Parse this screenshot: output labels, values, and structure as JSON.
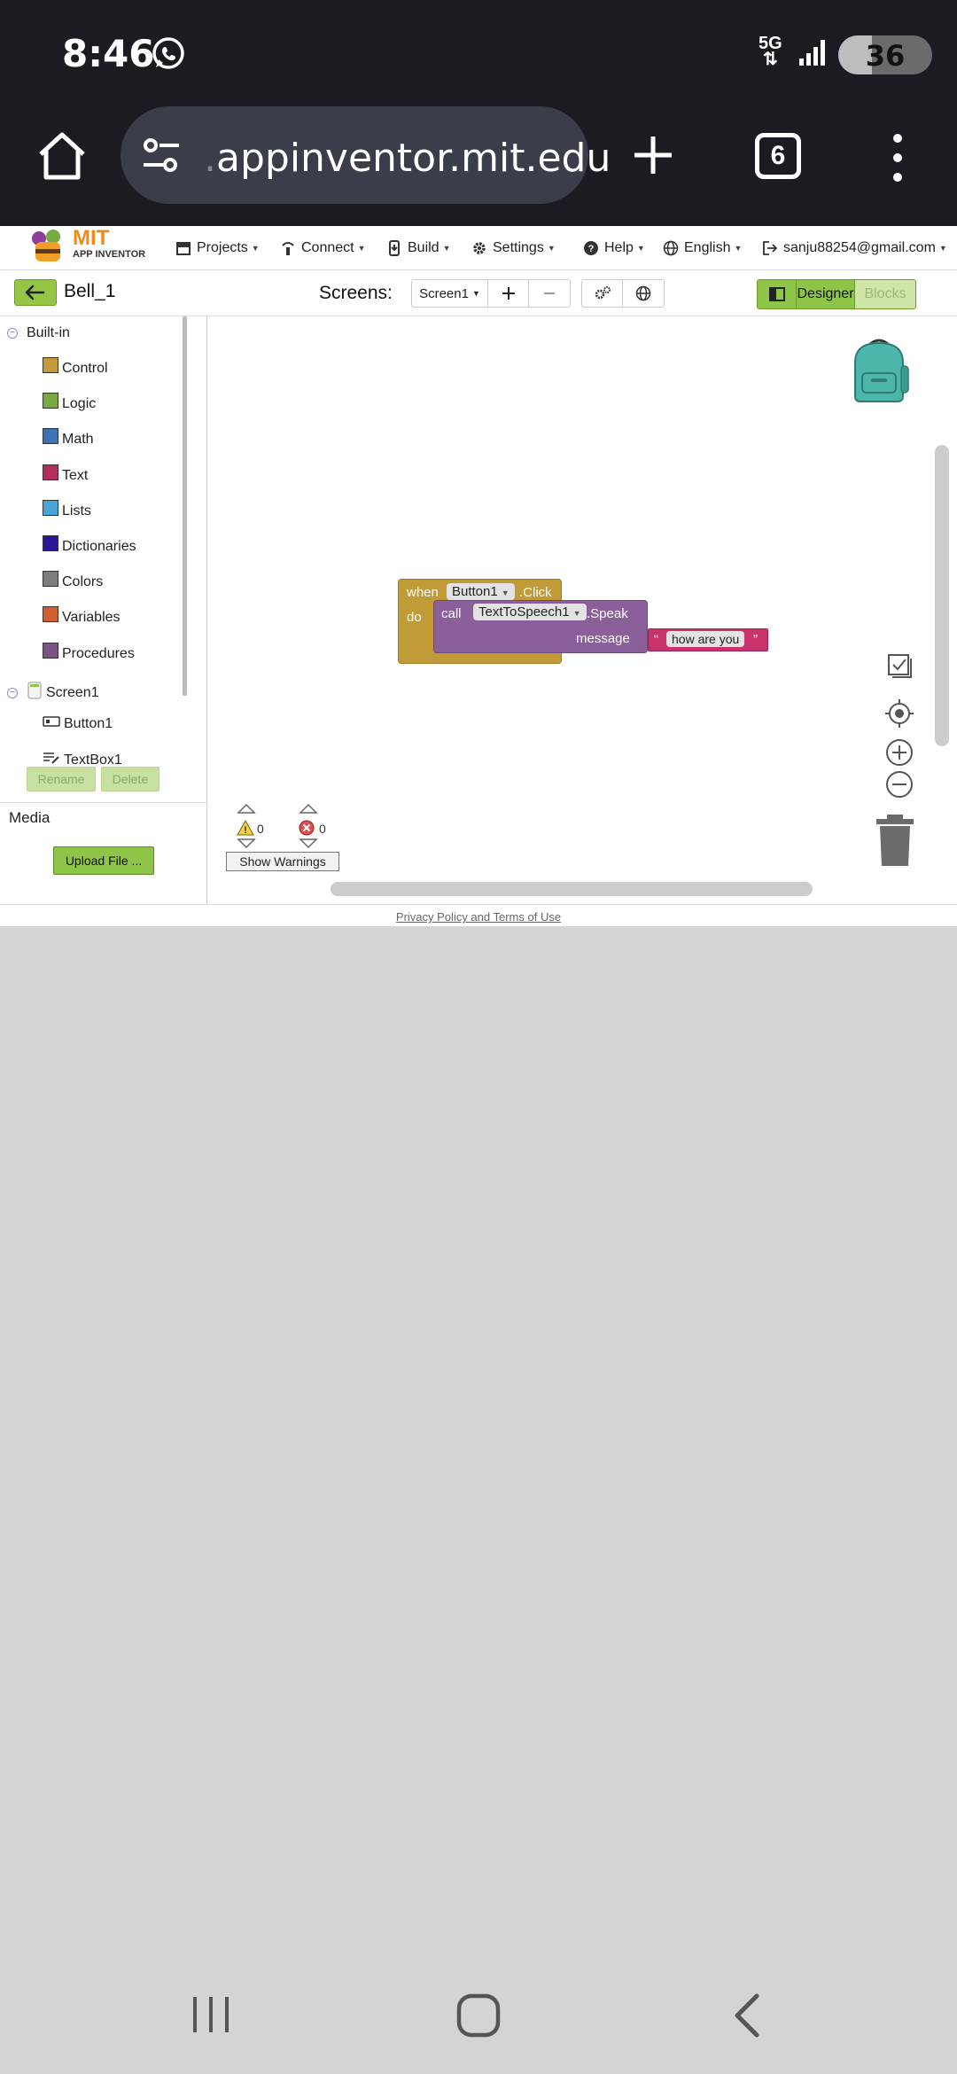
{
  "status_bar": {
    "time": "8:46",
    "network": "5G",
    "battery": "36",
    "battery_level": 0.36
  },
  "browser": {
    "url_prefix": ".",
    "url": "appinventor.mit.edu",
    "tab_count": "6"
  },
  "logo": {
    "title": "MIT",
    "subtitle": "APP INVENTOR"
  },
  "topnav": {
    "projects": "Projects",
    "connect": "Connect",
    "build": "Build",
    "settings": "Settings",
    "help": "Help",
    "language": "English",
    "account": "sanju88254@gmail.com"
  },
  "toolbar": {
    "project_name": "Bell_1",
    "screens_label": "Screens:",
    "screen_select": "Screen1",
    "designer": "Designer",
    "blocks": "Blocks"
  },
  "sidebar": {
    "builtin_label": "Built-in",
    "builtin": [
      {
        "label": "Control",
        "color": "#c09b38"
      },
      {
        "label": "Logic",
        "color": "#77ab41"
      },
      {
        "label": "Math",
        "color": "#3f71b5"
      },
      {
        "label": "Text",
        "color": "#b32d5e"
      },
      {
        "label": "Lists",
        "color": "#49a6d4"
      },
      {
        "label": "Dictionaries",
        "color": "#2d1799"
      },
      {
        "label": "Colors",
        "color": "#7d7d7d"
      },
      {
        "label": "Variables",
        "color": "#d05f2d"
      },
      {
        "label": "Procedures",
        "color": "#7c5385"
      }
    ],
    "screen_label": "Screen1",
    "components": [
      "Button1",
      "TextBox1"
    ],
    "rename": "Rename",
    "delete": "Delete",
    "media_label": "Media",
    "upload": "Upload File ..."
  },
  "blocks": {
    "event": {
      "when": "when",
      "component": "Button1",
      "event": ".Click",
      "do": "do"
    },
    "call": {
      "call": "call",
      "component": "TextToSpeech1",
      "method": ".Speak",
      "param": "message"
    },
    "text": {
      "open_quote": "“",
      "value": "how are you",
      "close_quote": "”"
    }
  },
  "warnings": {
    "warning_count": "0",
    "error_count": "0",
    "show_warnings": "Show Warnings"
  },
  "footer": {
    "privacy": "Privacy Policy and Terms of Use"
  }
}
